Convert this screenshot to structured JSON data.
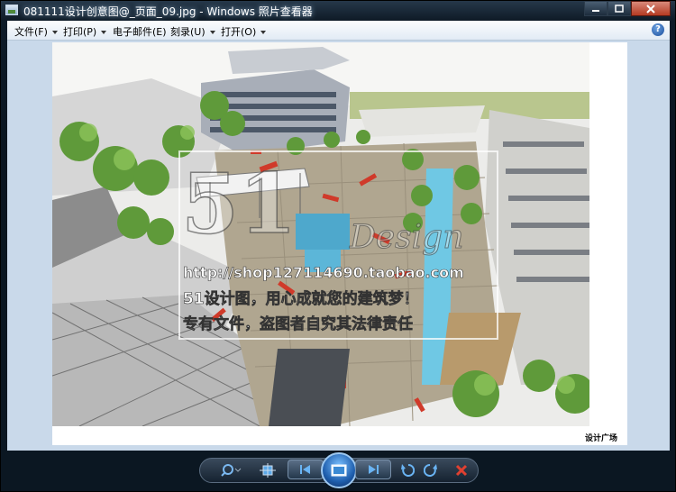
{
  "window": {
    "title": "081111设计创意图@_页面_09.jpg - Windows 照片查看器"
  },
  "menu": {
    "items": [
      {
        "label": "文件(F)"
      },
      {
        "label": "打印(P)"
      },
      {
        "label": "电子邮件(E)"
      },
      {
        "label": "刻录(U)"
      },
      {
        "label": "打开(O)"
      }
    ],
    "help_label": "?"
  },
  "image": {
    "watermark_big": "51",
    "watermark_design": "Design",
    "watermark_url": "http://shop127114690.taobao.com",
    "watermark_line1": "51设计图，用心成就您的建筑梦！",
    "watermark_line2": "专有文件，盗图者自究其法律责任",
    "caption": "设计广场"
  },
  "colors": {
    "accent": "#1f5fae",
    "close": "#b43a22",
    "delete": "#d83a2a"
  },
  "toolbar": {
    "icons": [
      "zoom-icon",
      "actual-size-icon",
      "previous-icon",
      "slideshow-icon",
      "next-icon",
      "rotate-counterclockwise-icon",
      "rotate-clockwise-icon",
      "delete-icon"
    ]
  }
}
